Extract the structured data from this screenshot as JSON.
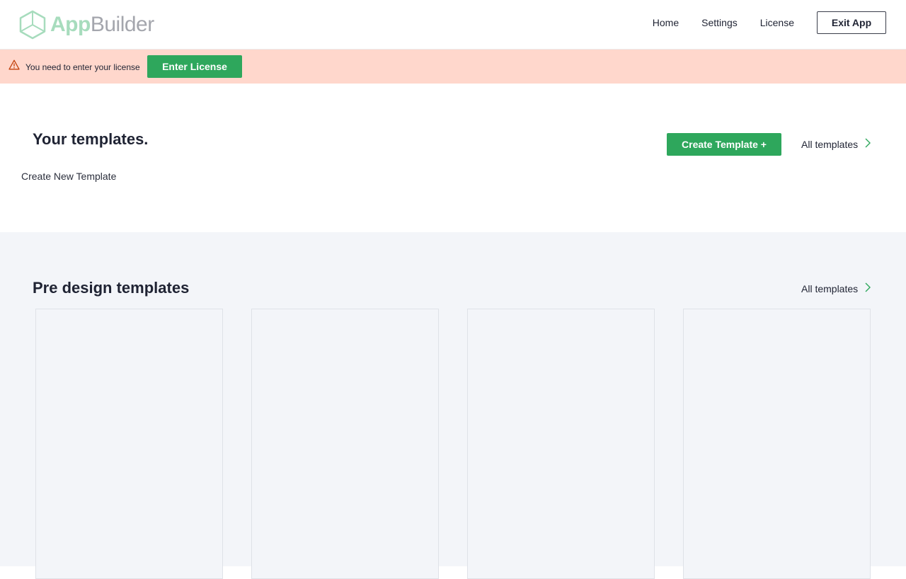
{
  "header": {
    "logo": {
      "part1": "App",
      "part2": "Builder",
      "icon": "hexagon-cube-icon"
    },
    "nav": [
      {
        "label": "Home"
      },
      {
        "label": "Settings"
      },
      {
        "label": "License"
      }
    ],
    "exit_label": "Exit App"
  },
  "license_bar": {
    "icon": "warning-icon",
    "message": "You need to enter your license",
    "button_label": "Enter License"
  },
  "your_templates": {
    "title": "Your templates.",
    "create_button": "Create Template +",
    "all_link": "All templates",
    "create_new_link": "Create New Template"
  },
  "predesign": {
    "title": "Pre design templates",
    "all_link": "All templates",
    "card_count": 4
  },
  "colors": {
    "accent": "#2ea75c",
    "logo_green": "#a7dcbd",
    "logo_gray": "#a4a6ad",
    "alert_bg": "#ffd7cc",
    "alert_icon": "#c2410c",
    "section_bg": "#f3f5f9",
    "text": "#1f2333"
  }
}
